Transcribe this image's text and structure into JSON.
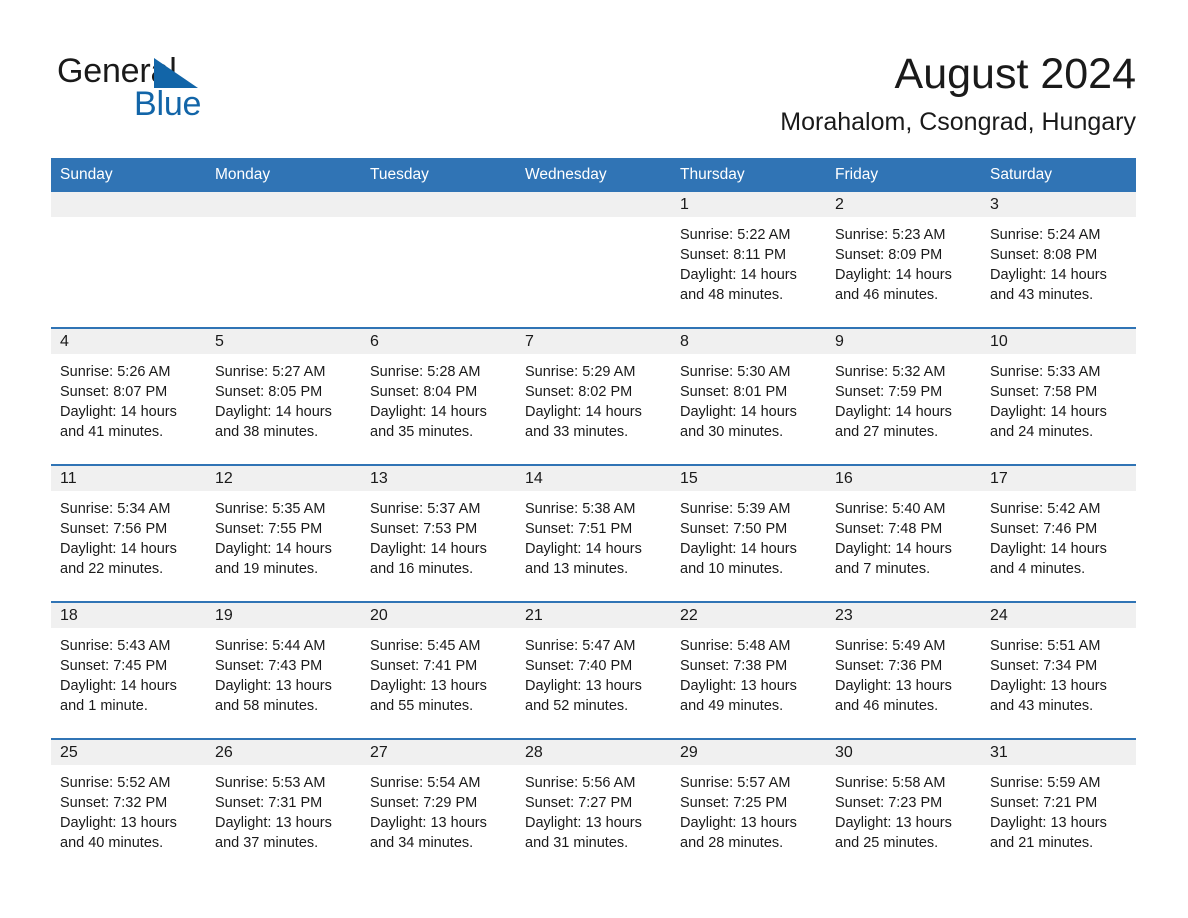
{
  "brand": {
    "name_part1": "General",
    "name_part2": "Blue",
    "accent_color": "#1265a8"
  },
  "header": {
    "month_title": "August 2024",
    "location": "Morahalom, Csongrad, Hungary"
  },
  "theme": {
    "header_blue": "#3074b5",
    "daynum_strip_gray": "#f0f0f0",
    "text_black": "#1a1a1a"
  },
  "calendar": {
    "weekday_headers": [
      "Sunday",
      "Monday",
      "Tuesday",
      "Wednesday",
      "Thursday",
      "Friday",
      "Saturday"
    ],
    "weeks": [
      [
        {
          "day": "",
          "sunrise": "",
          "sunset": "",
          "daylight": "",
          "blank": true
        },
        {
          "day": "",
          "sunrise": "",
          "sunset": "",
          "daylight": "",
          "blank": true
        },
        {
          "day": "",
          "sunrise": "",
          "sunset": "",
          "daylight": "",
          "blank": true
        },
        {
          "day": "",
          "sunrise": "",
          "sunset": "",
          "daylight": "",
          "blank": true
        },
        {
          "day": "1",
          "sunrise": "Sunrise: 5:22 AM",
          "sunset": "Sunset: 8:11 PM",
          "daylight": "Daylight: 14 hours and 48 minutes.",
          "blank": false
        },
        {
          "day": "2",
          "sunrise": "Sunrise: 5:23 AM",
          "sunset": "Sunset: 8:09 PM",
          "daylight": "Daylight: 14 hours and 46 minutes.",
          "blank": false
        },
        {
          "day": "3",
          "sunrise": "Sunrise: 5:24 AM",
          "sunset": "Sunset: 8:08 PM",
          "daylight": "Daylight: 14 hours and 43 minutes.",
          "blank": false
        }
      ],
      [
        {
          "day": "4",
          "sunrise": "Sunrise: 5:26 AM",
          "sunset": "Sunset: 8:07 PM",
          "daylight": "Daylight: 14 hours and 41 minutes.",
          "blank": false
        },
        {
          "day": "5",
          "sunrise": "Sunrise: 5:27 AM",
          "sunset": "Sunset: 8:05 PM",
          "daylight": "Daylight: 14 hours and 38 minutes.",
          "blank": false
        },
        {
          "day": "6",
          "sunrise": "Sunrise: 5:28 AM",
          "sunset": "Sunset: 8:04 PM",
          "daylight": "Daylight: 14 hours and 35 minutes.",
          "blank": false
        },
        {
          "day": "7",
          "sunrise": "Sunrise: 5:29 AM",
          "sunset": "Sunset: 8:02 PM",
          "daylight": "Daylight: 14 hours and 33 minutes.",
          "blank": false
        },
        {
          "day": "8",
          "sunrise": "Sunrise: 5:30 AM",
          "sunset": "Sunset: 8:01 PM",
          "daylight": "Daylight: 14 hours and 30 minutes.",
          "blank": false
        },
        {
          "day": "9",
          "sunrise": "Sunrise: 5:32 AM",
          "sunset": "Sunset: 7:59 PM",
          "daylight": "Daylight: 14 hours and 27 minutes.",
          "blank": false
        },
        {
          "day": "10",
          "sunrise": "Sunrise: 5:33 AM",
          "sunset": "Sunset: 7:58 PM",
          "daylight": "Daylight: 14 hours and 24 minutes.",
          "blank": false
        }
      ],
      [
        {
          "day": "11",
          "sunrise": "Sunrise: 5:34 AM",
          "sunset": "Sunset: 7:56 PM",
          "daylight": "Daylight: 14 hours and 22 minutes.",
          "blank": false
        },
        {
          "day": "12",
          "sunrise": "Sunrise: 5:35 AM",
          "sunset": "Sunset: 7:55 PM",
          "daylight": "Daylight: 14 hours and 19 minutes.",
          "blank": false
        },
        {
          "day": "13",
          "sunrise": "Sunrise: 5:37 AM",
          "sunset": "Sunset: 7:53 PM",
          "daylight": "Daylight: 14 hours and 16 minutes.",
          "blank": false
        },
        {
          "day": "14",
          "sunrise": "Sunrise: 5:38 AM",
          "sunset": "Sunset: 7:51 PM",
          "daylight": "Daylight: 14 hours and 13 minutes.",
          "blank": false
        },
        {
          "day": "15",
          "sunrise": "Sunrise: 5:39 AM",
          "sunset": "Sunset: 7:50 PM",
          "daylight": "Daylight: 14 hours and 10 minutes.",
          "blank": false
        },
        {
          "day": "16",
          "sunrise": "Sunrise: 5:40 AM",
          "sunset": "Sunset: 7:48 PM",
          "daylight": "Daylight: 14 hours and 7 minutes.",
          "blank": false
        },
        {
          "day": "17",
          "sunrise": "Sunrise: 5:42 AM",
          "sunset": "Sunset: 7:46 PM",
          "daylight": "Daylight: 14 hours and 4 minutes.",
          "blank": false
        }
      ],
      [
        {
          "day": "18",
          "sunrise": "Sunrise: 5:43 AM",
          "sunset": "Sunset: 7:45 PM",
          "daylight": "Daylight: 14 hours and 1 minute.",
          "blank": false
        },
        {
          "day": "19",
          "sunrise": "Sunrise: 5:44 AM",
          "sunset": "Sunset: 7:43 PM",
          "daylight": "Daylight: 13 hours and 58 minutes.",
          "blank": false
        },
        {
          "day": "20",
          "sunrise": "Sunrise: 5:45 AM",
          "sunset": "Sunset: 7:41 PM",
          "daylight": "Daylight: 13 hours and 55 minutes.",
          "blank": false
        },
        {
          "day": "21",
          "sunrise": "Sunrise: 5:47 AM",
          "sunset": "Sunset: 7:40 PM",
          "daylight": "Daylight: 13 hours and 52 minutes.",
          "blank": false
        },
        {
          "day": "22",
          "sunrise": "Sunrise: 5:48 AM",
          "sunset": "Sunset: 7:38 PM",
          "daylight": "Daylight: 13 hours and 49 minutes.",
          "blank": false
        },
        {
          "day": "23",
          "sunrise": "Sunrise: 5:49 AM",
          "sunset": "Sunset: 7:36 PM",
          "daylight": "Daylight: 13 hours and 46 minutes.",
          "blank": false
        },
        {
          "day": "24",
          "sunrise": "Sunrise: 5:51 AM",
          "sunset": "Sunset: 7:34 PM",
          "daylight": "Daylight: 13 hours and 43 minutes.",
          "blank": false
        }
      ],
      [
        {
          "day": "25",
          "sunrise": "Sunrise: 5:52 AM",
          "sunset": "Sunset: 7:32 PM",
          "daylight": "Daylight: 13 hours and 40 minutes.",
          "blank": false
        },
        {
          "day": "26",
          "sunrise": "Sunrise: 5:53 AM",
          "sunset": "Sunset: 7:31 PM",
          "daylight": "Daylight: 13 hours and 37 minutes.",
          "blank": false
        },
        {
          "day": "27",
          "sunrise": "Sunrise: 5:54 AM",
          "sunset": "Sunset: 7:29 PM",
          "daylight": "Daylight: 13 hours and 34 minutes.",
          "blank": false
        },
        {
          "day": "28",
          "sunrise": "Sunrise: 5:56 AM",
          "sunset": "Sunset: 7:27 PM",
          "daylight": "Daylight: 13 hours and 31 minutes.",
          "blank": false
        },
        {
          "day": "29",
          "sunrise": "Sunrise: 5:57 AM",
          "sunset": "Sunset: 7:25 PM",
          "daylight": "Daylight: 13 hours and 28 minutes.",
          "blank": false
        },
        {
          "day": "30",
          "sunrise": "Sunrise: 5:58 AM",
          "sunset": "Sunset: 7:23 PM",
          "daylight": "Daylight: 13 hours and 25 minutes.",
          "blank": false
        },
        {
          "day": "31",
          "sunrise": "Sunrise: 5:59 AM",
          "sunset": "Sunset: 7:21 PM",
          "daylight": "Daylight: 13 hours and 21 minutes.",
          "blank": false
        }
      ]
    ]
  }
}
